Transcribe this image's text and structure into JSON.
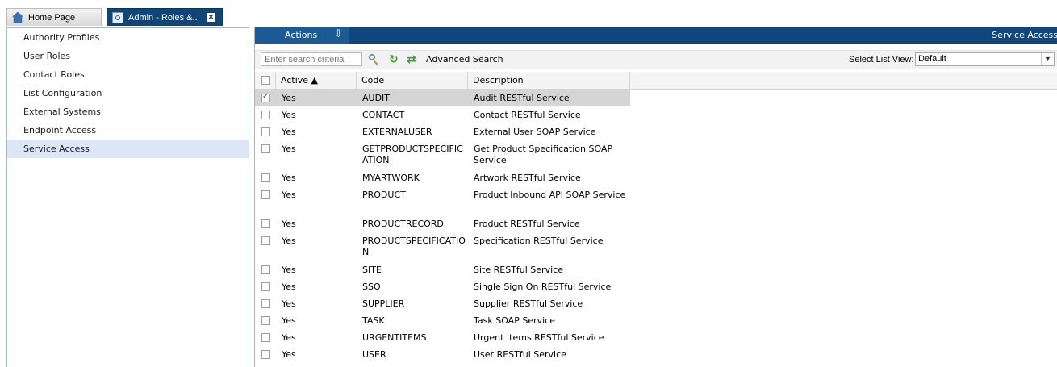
{
  "tabs": {
    "home": "Home Page",
    "admin": "Admin - Roles &.."
  },
  "sidebar": {
    "items": [
      {
        "label": "Authority Profiles"
      },
      {
        "label": "User Roles"
      },
      {
        "label": "Contact Roles"
      },
      {
        "label": "List Configuration"
      },
      {
        "label": "External Systems"
      },
      {
        "label": "Endpoint Access"
      },
      {
        "label": "Service Access",
        "active": true
      }
    ]
  },
  "toolbar": {
    "actions_label": "Actions",
    "title": "Service Access",
    "search_placeholder": "Enter search criteria",
    "advanced_search": "Advanced Search",
    "list_view_label": "Select List View:",
    "list_view_value": "Default"
  },
  "table": {
    "columns": [
      "Active ▲",
      "Code",
      "Description"
    ],
    "rows": [
      {
        "active": "Yes",
        "code": "AUDIT",
        "description": "Audit RESTful Service",
        "checked": true
      },
      {
        "active": "Yes",
        "code": "CONTACT",
        "description": "Contact RESTful Service"
      },
      {
        "active": "Yes",
        "code": "EXTERNALUSER",
        "description": "External User SOAP Service"
      },
      {
        "active": "Yes",
        "code": "GETPRODUCTSPECIFICATION",
        "description": "Get Product Specification SOAP Service"
      },
      {
        "active": "Yes",
        "code": "MYARTWORK",
        "description": "Artwork RESTful Service"
      },
      {
        "active": "Yes",
        "code": "PRODUCT",
        "description": "Product Inbound API SOAP Service"
      },
      {
        "active": "Yes",
        "code": "PRODUCTRECORD",
        "description": "Product RESTful Service"
      },
      {
        "active": "Yes",
        "code": "PRODUCTSPECIFICATION",
        "description": "Specification RESTful Service"
      },
      {
        "active": "Yes",
        "code": "SITE",
        "description": "Site RESTful Service"
      },
      {
        "active": "Yes",
        "code": "SSO",
        "description": "Single Sign On RESTful Service"
      },
      {
        "active": "Yes",
        "code": "SUPPLIER",
        "description": "Supplier RESTful Service"
      },
      {
        "active": "Yes",
        "code": "TASK",
        "description": "Task SOAP Service"
      },
      {
        "active": "Yes",
        "code": "URGENTITEMS",
        "description": "Urgent Items RESTful Service"
      },
      {
        "active": "Yes",
        "code": "USER",
        "description": "User RESTful Service"
      }
    ]
  }
}
